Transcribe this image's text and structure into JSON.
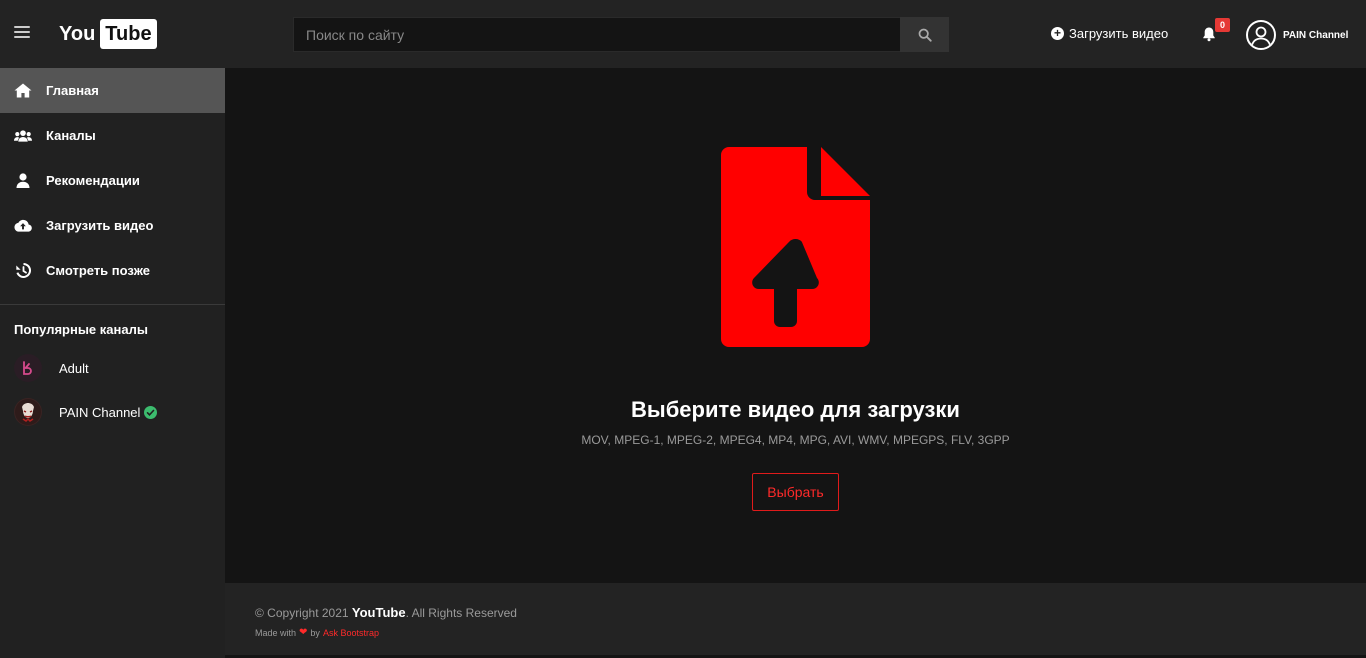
{
  "header": {
    "logo_left": "You",
    "logo_right": "Tube",
    "search_placeholder": "Поиск по сайту",
    "upload_label": "Загрузить видео",
    "notification_count": "0",
    "account_name": "PAIN Channel"
  },
  "sidebar": {
    "items": [
      {
        "label": "Главная",
        "icon": "home-icon",
        "active": true
      },
      {
        "label": "Каналы",
        "icon": "users-icon"
      },
      {
        "label": "Рекомендации",
        "icon": "user-icon"
      },
      {
        "label": "Загрузить видео",
        "icon": "cloud-upload-icon"
      },
      {
        "label": "Смотреть позже",
        "icon": "history-icon"
      }
    ],
    "section_title": "Популярные каналы",
    "channels": [
      {
        "name": "Adult",
        "verified": false
      },
      {
        "name": "PAIN Channel",
        "verified": true
      }
    ]
  },
  "main": {
    "title": "Выберите видео для загрузки",
    "formats": "MOV, MPEG-1, MPEG-2, MPEG4, MP4, MPG, AVI, WMV, MPEGPS, FLV, 3GPP",
    "choose_label": "Выбрать",
    "accent_color": "#ff0000"
  },
  "footer": {
    "copyright_prefix": "© Copyright 2021 ",
    "brand": "YouTube",
    "copyright_suffix": ". All Rights Reserved",
    "made_with": "Made with",
    "by": "by",
    "author_link": "Ask Bootstrap"
  }
}
